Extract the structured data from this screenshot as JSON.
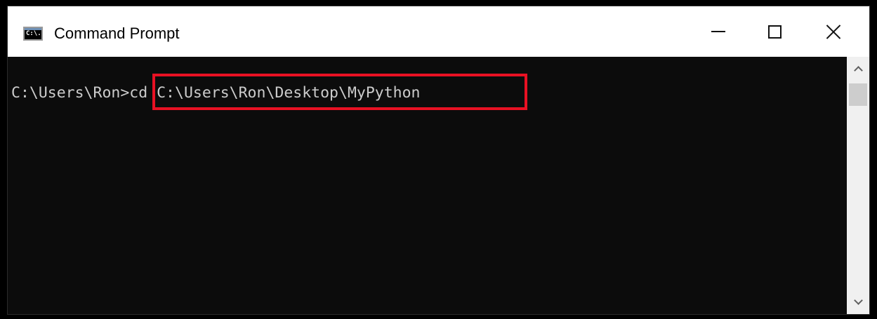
{
  "window": {
    "title": "Command Prompt",
    "icon_label": "C:\\.",
    "controls": [
      "minimize-icon",
      "maximize-icon",
      "close-icon"
    ]
  },
  "console": {
    "prompt": "C:\\Users\\Ron>",
    "command": "cd C:\\Users\\Ron\\Desktop\\MyPython",
    "text_color": "#cccccc",
    "background": "#0c0c0c"
  },
  "annotation": {
    "highlight_color": "#e81123"
  }
}
